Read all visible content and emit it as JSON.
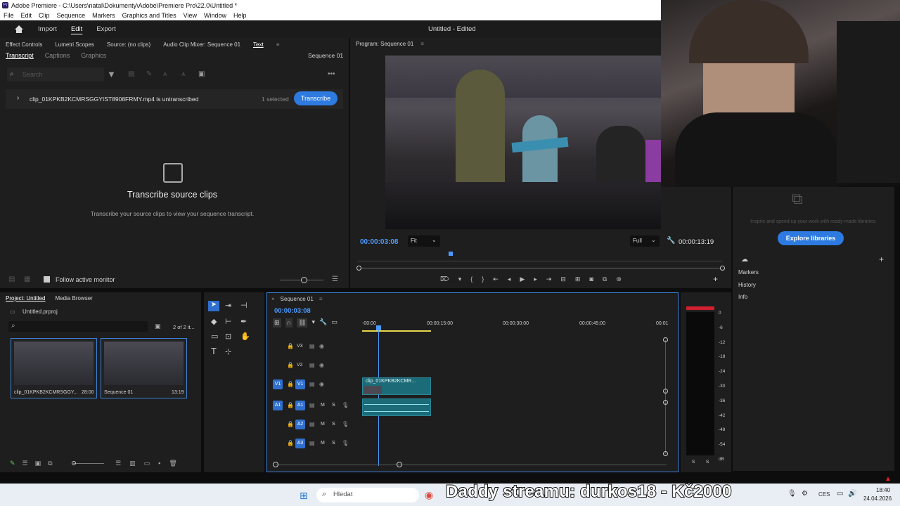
{
  "window": {
    "title": "Adobe Premiere - C:\\Users\\natal\\Dokumenty\\Adobe\\Premiere Pro\\22.0\\Untitled *"
  },
  "menu": [
    "File",
    "Edit",
    "Clip",
    "Sequence",
    "Markers",
    "Graphics and Titles",
    "View",
    "Window",
    "Help"
  ],
  "appbar": {
    "tabs": [
      "Import",
      "Edit",
      "Export"
    ],
    "active": "Edit",
    "title": "Untitled - Edited"
  },
  "source_panel": {
    "tabs": [
      "Effect Controls",
      "Lumetri Scopes",
      "Source: (no clips)",
      "Audio Clip Mixer: Sequence 01",
      "Text"
    ],
    "subtabs": [
      "Transcript",
      "Captions",
      "Graphics"
    ],
    "sequence": "Sequence 01",
    "search_placeholder": "Search",
    "clip_row": "clip_01KPKB2KCMRSGGYIST8908FRMY.mp4 is untranscribed",
    "selected": "1 selected",
    "transcribe_btn": "Transcribe",
    "empty_title": "Transcribe source clips",
    "empty_desc": "Transcribe your source clips to view your sequence transcript.",
    "follow": "Follow active monitor"
  },
  "program": {
    "title": "Program: Sequence 01",
    "timecode": "00:00:03:08",
    "fit": "Fit",
    "quality": "Full",
    "duration": "00:00:13:19",
    "playhead_pct": 0.25
  },
  "right_panel": {
    "lib_desc": "Inspire and speed up your work with ready-made libraries.",
    "explore_btn": "Explore libraries",
    "items": [
      "Markers",
      "History",
      "Info"
    ]
  },
  "project": {
    "tabs": [
      "Project: Untitled",
      "Media Browser"
    ],
    "file": "Untitled.prproj",
    "count": "2 of 2 it...",
    "items": [
      {
        "name": "clip_01KPKB2KCMRSGGY...",
        "dur": "28:00"
      },
      {
        "name": "Sequence 01",
        "dur": "13:19"
      }
    ]
  },
  "timeline": {
    "title": "Sequence 01",
    "timecode": "00:00:03:08",
    "ruler": [
      "-00:00",
      "00:00:15:00",
      "00:00:30:00",
      "00:00:45:00",
      "00:01"
    ],
    "tracks_video": [
      "V3",
      "V2",
      "V1"
    ],
    "tracks_audio": [
      "A1",
      "A2",
      "A3"
    ],
    "src_v": "V1",
    "src_a": "A1",
    "clip_label": "clip_01KPKB2KCMR...",
    "mute": "M",
    "solo": "S"
  },
  "meter": {
    "scale": [
      "0",
      "-6",
      "-12",
      "-18",
      "-24",
      "-30",
      "-36",
      "-42",
      "-48",
      "-54",
      "dB"
    ],
    "ch": [
      "S",
      "S"
    ]
  },
  "taskbar": {
    "search": "Hledat",
    "overlay": "Daddy streamu: durkos18 - Kč2000",
    "lang": "CES",
    "time": "18:40",
    "date": "24.04.2026"
  }
}
